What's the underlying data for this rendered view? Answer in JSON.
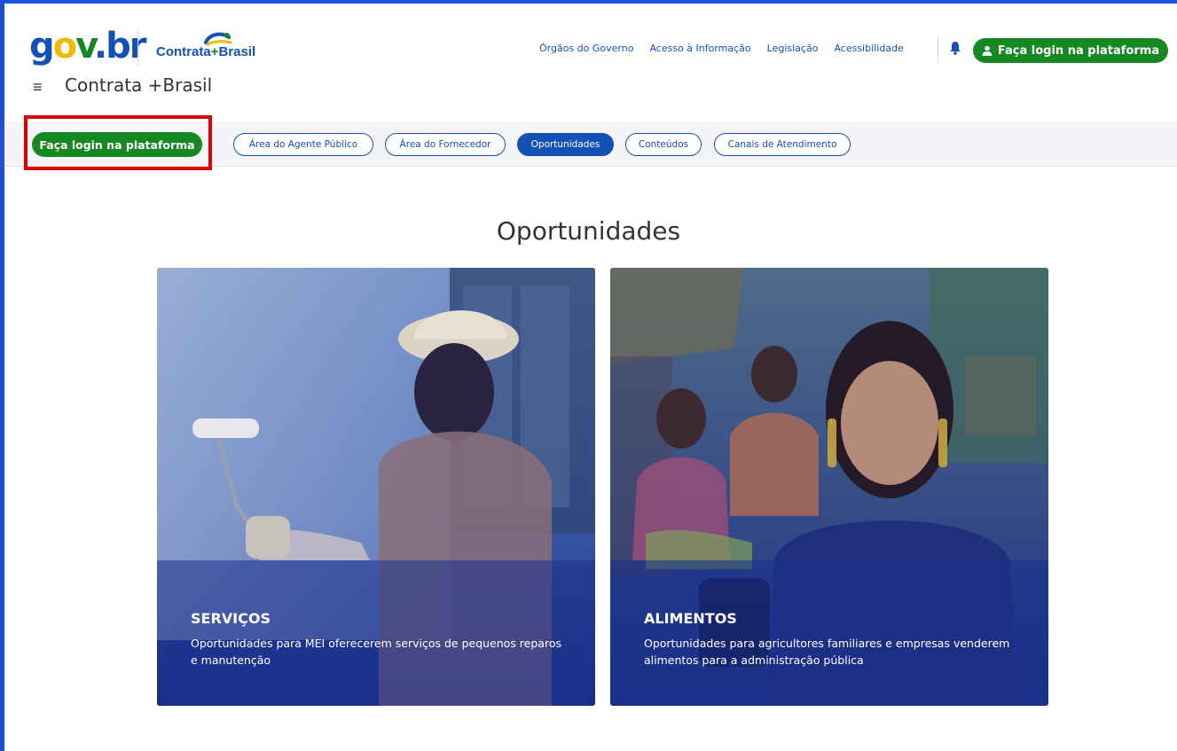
{
  "colors": {
    "brand_blue": "#1351b4",
    "brand_green": "#168821",
    "highlight_red": "#e00000"
  },
  "header": {
    "govbr_logo": {
      "g": "g",
      "o": "o",
      "v": "v",
      "dot": ".",
      "br": "br"
    },
    "contrata_logo": {
      "part1": "Contrata",
      "plus": "+",
      "part2": "Brasil"
    },
    "menu_icon": "menu-icon",
    "site_title": "Contrata +Brasil",
    "links": [
      "Órgãos do Governo",
      "Acesso à Informação",
      "Legislação",
      "Acessibilidade"
    ],
    "bell_icon": "bell-icon",
    "login_button": "Faça login na plataforma"
  },
  "nav": {
    "login_button": "Faça login na plataforma",
    "items": [
      {
        "label": "Área do Agente Público",
        "active": false
      },
      {
        "label": "Área do Fornecedor",
        "active": false
      },
      {
        "label": "Oportunidades",
        "active": true
      },
      {
        "label": "Conteúdos",
        "active": false
      },
      {
        "label": "Canais de Atendimento",
        "active": false
      }
    ]
  },
  "main": {
    "heading": "Oportunidades",
    "cards": [
      {
        "title": "SERVIÇOS",
        "description": "Oportunidades para MEI oferecerem serviços de pequenos reparos e manutenção"
      },
      {
        "title": "ALIMENTOS",
        "description": "Oportunidades para agricultores familiares e empresas venderem alimentos para a administração pública"
      }
    ]
  }
}
